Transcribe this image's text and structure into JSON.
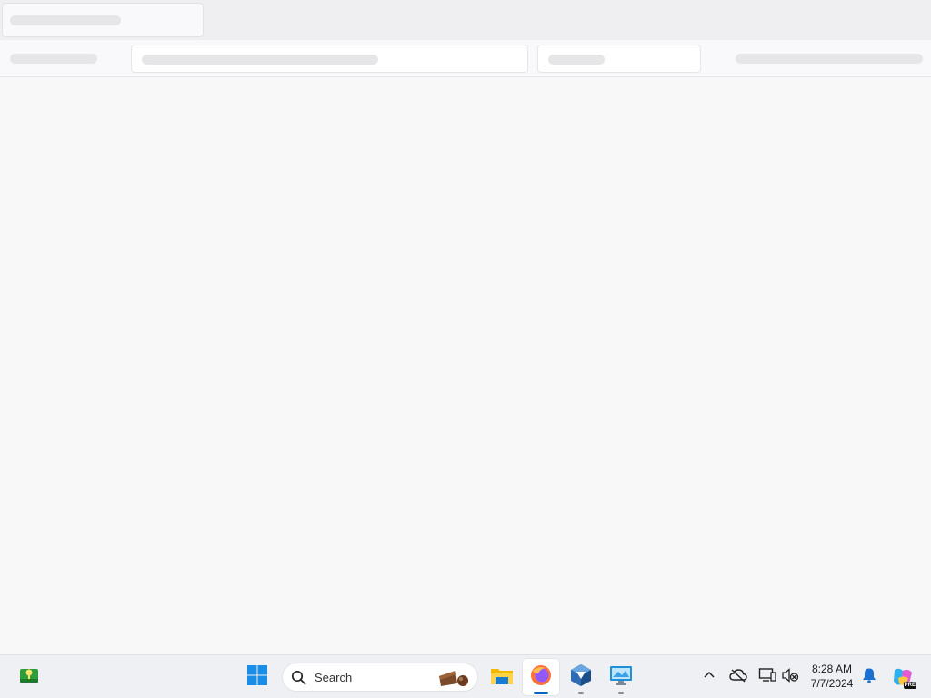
{
  "taskbar": {
    "search": {
      "placeholder": "Search"
    },
    "clock": {
      "time": "8:28 AM",
      "date": "7/7/2024"
    },
    "pinned": [
      "widgets-icon",
      "start-icon",
      "file-explorer-icon",
      "firefox-icon",
      "virtualbox-icon",
      "remote-desktop-icon"
    ],
    "copilot_badge": "PRE"
  },
  "colors": {
    "accent": "#0067c0",
    "taskbar_bg": "#eef0f3",
    "page_bg": "#f8f8f8"
  }
}
